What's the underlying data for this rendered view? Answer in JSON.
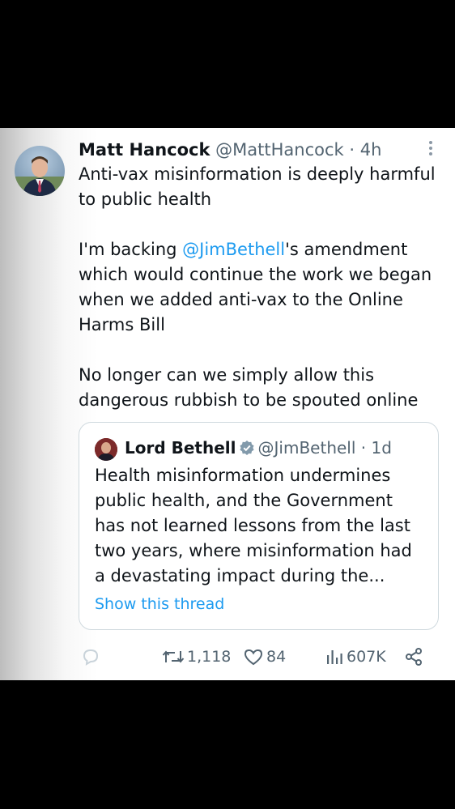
{
  "tweet": {
    "author_name": "Matt Hancock",
    "author_handle": "@MattHancock",
    "time": "· 4h",
    "paragraphs": {
      "p1": "Anti-vax misinformation is deeply harmful to public health",
      "p2_prefix": "I'm backing ",
      "p2_mention": "@JimBethell",
      "p2_suffix": "'s amendment which would continue the work we began when we added anti-vax to the Online Harms Bill",
      "p3": "No longer can we simply allow this dangerous rubbish to be spouted online"
    }
  },
  "quote": {
    "author_name": "Lord Bethell",
    "author_handle": "@JimBethell",
    "time": "· 1d",
    "text": "Health misinformation undermines public health, and the Government has not learned lessons from the last two years, where misinformation had a devastating impact during the...",
    "show_thread": "Show this thread"
  },
  "actions": {
    "retweets": "1,118",
    "likes": "84",
    "views": "607K"
  },
  "colors": {
    "link": "#1d9bf0",
    "secondary": "#536471",
    "text": "#0f1419"
  },
  "icons": [
    "reply-icon",
    "retweet-icon",
    "like-icon",
    "views-icon",
    "share-icon",
    "more-icon",
    "verified-icon"
  ]
}
